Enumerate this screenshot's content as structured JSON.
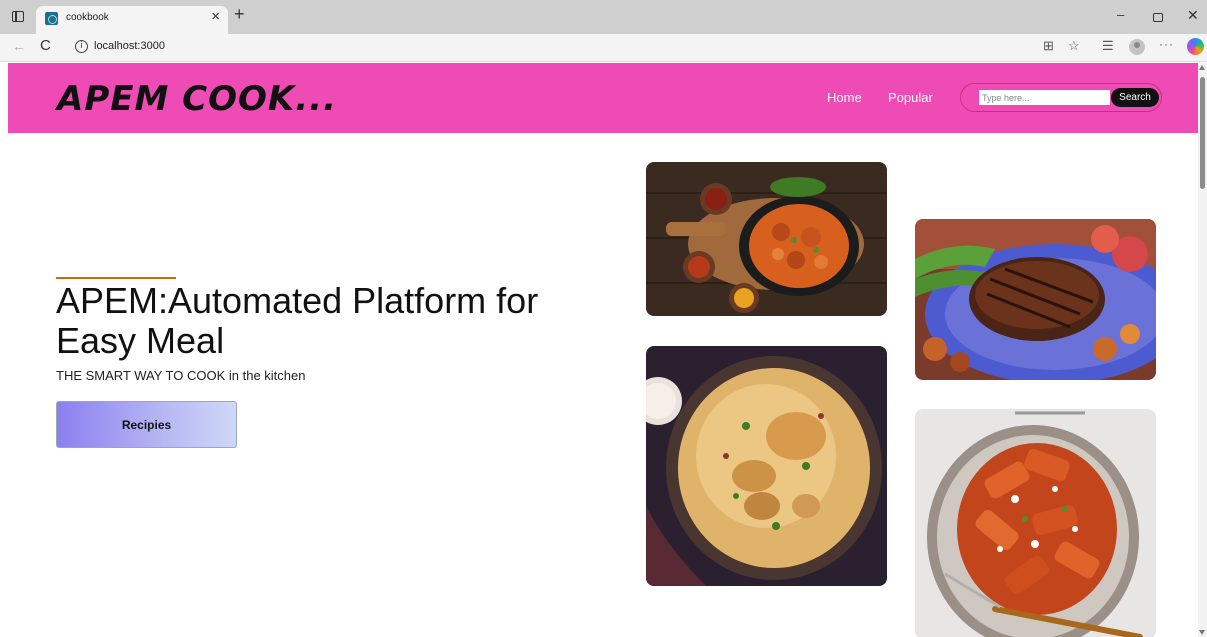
{
  "browser": {
    "tab_title": "cookbook",
    "tab_close": "×",
    "new_tab": "+",
    "url": "localhost:3000",
    "min": "–",
    "close": "✕",
    "back": "←",
    "reload": "C",
    "more": "···",
    "icons": [
      "split-screen-icon",
      "favorites-star-icon",
      "collections-icon",
      "profile-icon",
      "more-icon",
      "copilot-icon"
    ]
  },
  "header": {
    "logo": "APEM COOK...",
    "nav": {
      "home": "Home",
      "popular": "Popular"
    },
    "search": {
      "placeholder": "Type here...",
      "button": "Search"
    },
    "color": "#ef4bb4"
  },
  "hero": {
    "title": "APEM:Automated Platform for Easy Meal",
    "subtitle": "THE SMART WAY TO COOK in the kitchen",
    "button": "Recipies",
    "accent_color": "#c56a1a"
  },
  "images": [
    {
      "name": "butter-chicken-image"
    },
    {
      "name": "grilled-steak-image"
    },
    {
      "name": "chicken-biryani-image"
    },
    {
      "name": "penne-pasta-image"
    }
  ]
}
